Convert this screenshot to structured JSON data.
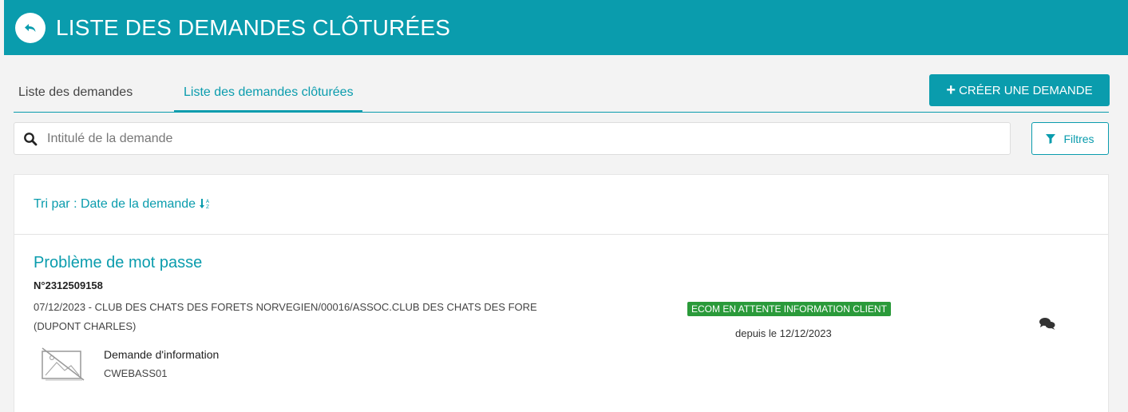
{
  "header": {
    "title": "LISTE DES DEMANDES CLÔTURÉES"
  },
  "tabs": [
    {
      "label": "Liste des demandes"
    },
    {
      "label": "Liste des demandes clôturées"
    }
  ],
  "actions": {
    "create_label": "CRÉER UNE DEMANDE",
    "filter_label": "Filtres"
  },
  "search": {
    "placeholder": "Intitulé de la demande",
    "value": ""
  },
  "sort": {
    "label": "Tri par : Date de la demande",
    "icon": "sort-alpha-icon"
  },
  "request": {
    "title": "Problème de mot passe",
    "number": "N°2312509158",
    "description": "07/12/2023 - CLUB DES CHATS DES FORETS NORVEGIEN/00016/ASSOC.CLUB DES CHATS DES FORE (DUPONT CHARLES)",
    "type": "Demande d'information",
    "code": "CWEBASS01",
    "status": "ECOM EN ATTENTE INFORMATION CLIENT",
    "since": "depuis le 12/12/2023"
  },
  "colors": {
    "accent": "#0a9cad",
    "status": "#2a9a3a"
  }
}
